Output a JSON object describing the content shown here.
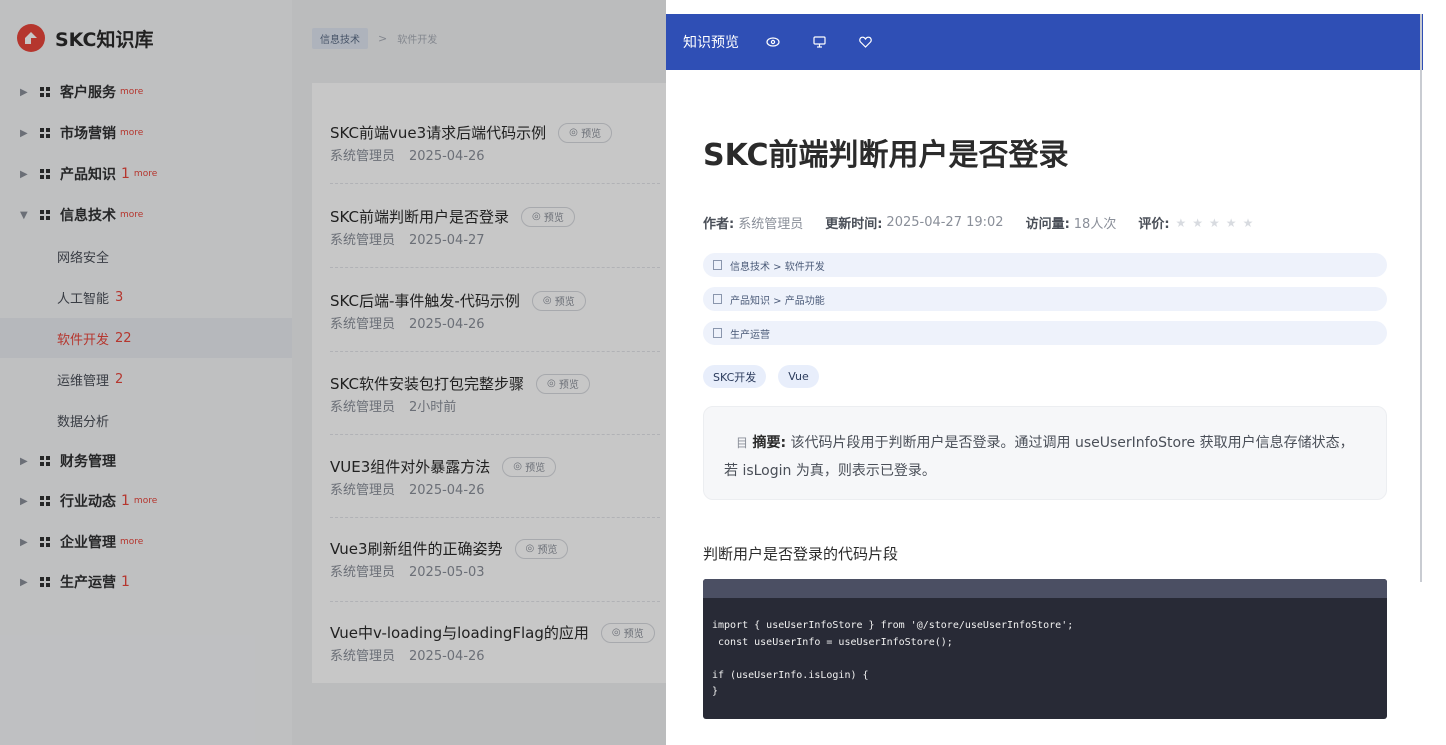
{
  "brand": {
    "name": "SKC知识库"
  },
  "sidebar": {
    "categories": [
      {
        "label": "客户服务",
        "count": "",
        "more": "more"
      },
      {
        "label": "市场营销",
        "count": "",
        "more": "more"
      },
      {
        "label": "产品知识",
        "count": "1",
        "more": "more"
      },
      {
        "label": "信息技术",
        "count": "",
        "more": "more",
        "expanded": true
      },
      {
        "label": "财务管理",
        "count": "",
        "more": ""
      },
      {
        "label": "行业动态",
        "count": "1",
        "more": "more"
      },
      {
        "label": "企业管理",
        "count": "",
        "more": "more"
      },
      {
        "label": "生产运营",
        "count": "1",
        "more": ""
      }
    ],
    "subitems": [
      {
        "label": "网络安全",
        "count": ""
      },
      {
        "label": "人工智能",
        "count": "3"
      },
      {
        "label": "软件开发",
        "count": "22",
        "active": true
      },
      {
        "label": "运维管理",
        "count": "2"
      },
      {
        "label": "数据分析",
        "count": ""
      }
    ]
  },
  "breadcrumb": {
    "parent": "信息技术",
    "separator": ">",
    "current": "软件开发"
  },
  "articles": [
    {
      "title": "SKC前端vue3请求后端代码示例",
      "author": "系统管理员",
      "date": "2025-04-26",
      "preview": "预览"
    },
    {
      "title": "SKC前端判断用户是否登录",
      "author": "系统管理员",
      "date": "2025-04-27",
      "preview": "预览"
    },
    {
      "title": "SKC后端-事件触发-代码示例",
      "author": "系统管理员",
      "date": "2025-04-26",
      "preview": "预览"
    },
    {
      "title": "SKC软件安装包打包完整步骤",
      "author": "系统管理员",
      "date": "2小时前",
      "preview": "预览"
    },
    {
      "title": "VUE3组件对外暴露方法",
      "author": "系统管理员",
      "date": "2025-04-26",
      "preview": "预览"
    },
    {
      "title": "Vue3刷新组件的正确姿势",
      "author": "系统管理员",
      "date": "2025-05-03",
      "preview": "预览"
    },
    {
      "title": "Vue中v-loading与loadingFlag的应用",
      "author": "系统管理员",
      "date": "2025-04-26",
      "preview": "预览"
    }
  ],
  "drawer": {
    "header_title": "知识预览",
    "header_icons": [
      "eye-icon",
      "monitor-icon",
      "heart-icon"
    ],
    "title": "SKC前端判断用户是否登录",
    "meta": {
      "author_label": "作者:",
      "author": "系统管理员",
      "updated_label": "更新时间:",
      "updated": "2025-04-27 19:02",
      "views_label": "访问量:",
      "views": "18人次",
      "rating_label": "评价:",
      "stars": "★★★★★",
      "rating_stars": 0
    },
    "paths": [
      "信息技术 > 软件开发",
      "产品知识 > 产品功能",
      "生产运营"
    ],
    "tags": [
      "SKC开发",
      "Vue"
    ],
    "summary_icon": "目",
    "summary_label": "摘要:",
    "summary_text": "该代码片段用于判断用户是否登录。通过调用 useUserInfoStore 获取用户信息存储状态，若 isLogin 为真，则表示已登录。",
    "section_title": "判断用户是否登录的代码片段",
    "code": "import { useUserInfoStore } from '@/store/useUserInfoStore';\n const useUserInfo = useUserInfoStore();\n\nif (useUserInfo.isLogin) {\n}"
  },
  "colors": {
    "brand_red": "#e8463c",
    "header_blue": "#2f4fb5"
  }
}
